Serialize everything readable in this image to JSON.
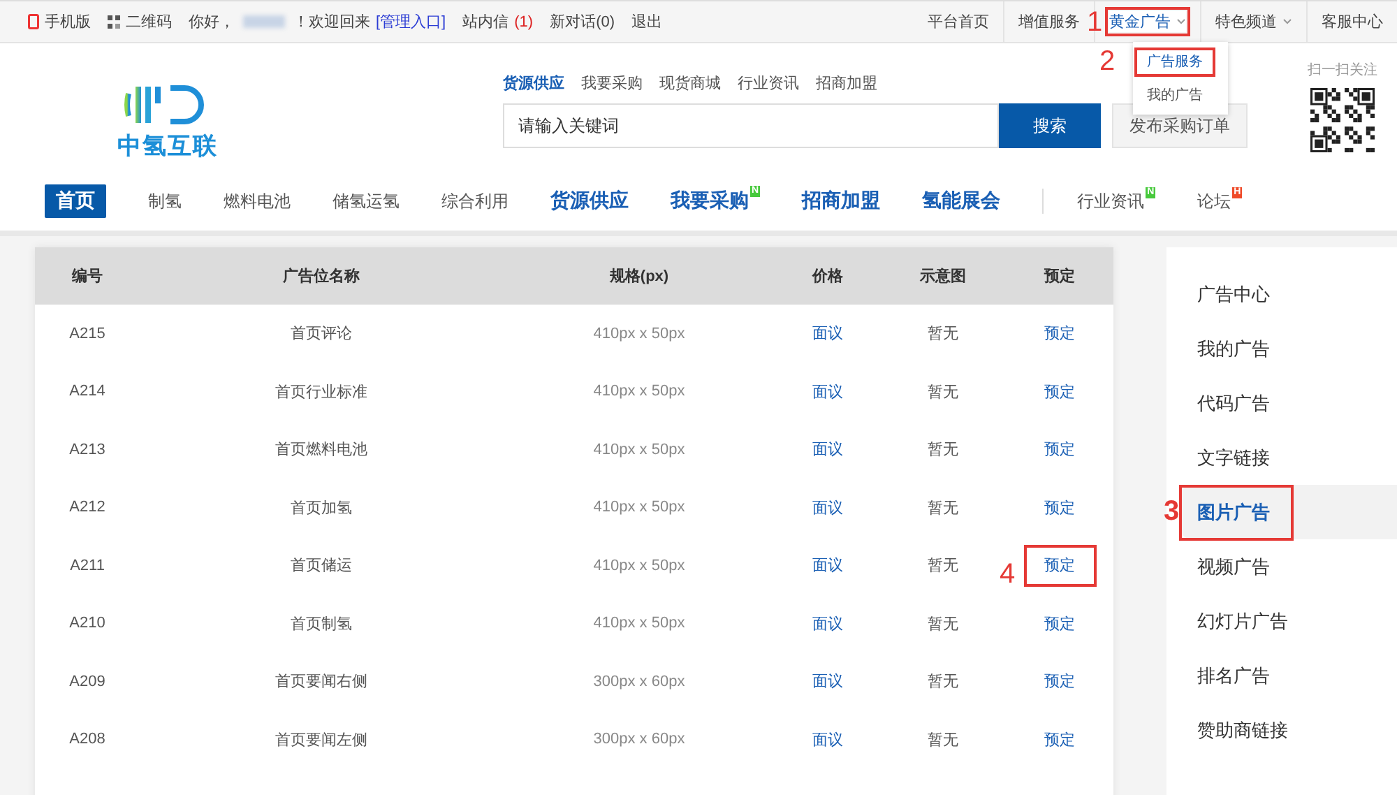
{
  "top_bar": {
    "left": [
      {
        "kind": "mobile",
        "label": "手机版"
      },
      {
        "kind": "qr",
        "label": "二维码"
      }
    ],
    "greeting_before": "你好，",
    "greeting_after": "！欢迎回来",
    "admin_link": "[管理入口]",
    "messages": "站内信",
    "messages_count": "(1)",
    "chats": "新对话(0)",
    "logout": "退出",
    "right": [
      {
        "label": "平台首页",
        "dropdown": false,
        "open": false
      },
      {
        "label": "增值服务",
        "dropdown": false,
        "open": false
      },
      {
        "label": "黄金广告",
        "dropdown": true,
        "annotation": "1",
        "open": true
      },
      {
        "label": "特色频道",
        "dropdown": true,
        "open": false
      },
      {
        "label": "客服中心",
        "dropdown": false,
        "open": false
      }
    ],
    "dropdown_menu": [
      {
        "label": "广告服务",
        "selected": true,
        "annotation": "2"
      },
      {
        "label": "我的广告",
        "selected": false
      }
    ]
  },
  "logo": {
    "text": "中氢互联"
  },
  "search": {
    "links": [
      {
        "label": "货源供应",
        "selected": true
      },
      {
        "label": "我要采购",
        "selected": false
      },
      {
        "label": "现货商城",
        "selected": false
      },
      {
        "label": "行业资讯",
        "selected": false
      },
      {
        "label": "招商加盟",
        "selected": false
      }
    ],
    "placeholder": "请输入关键词",
    "button": "搜索",
    "publish_button": "发布采购订单"
  },
  "qr": {
    "caption": "扫一扫关注"
  },
  "main_nav": [
    {
      "label": "首页",
      "kind": "active"
    },
    {
      "label": "制氢",
      "kind": "plain"
    },
    {
      "label": "燃料电池",
      "kind": "plain"
    },
    {
      "label": "储氢运氢",
      "kind": "plain"
    },
    {
      "label": "综合利用",
      "kind": "plain"
    },
    {
      "label": "货源供应",
      "kind": "featured"
    },
    {
      "label": "我要采购",
      "kind": "featured",
      "badge": "N"
    },
    {
      "label": "招商加盟",
      "kind": "featured"
    },
    {
      "label": "氢能展会",
      "kind": "featured"
    },
    {
      "label": "行业资讯",
      "kind": "plain",
      "badge": "N",
      "divider_before": true
    },
    {
      "label": "论坛",
      "kind": "plain",
      "badge": "H"
    }
  ],
  "table": {
    "columns": [
      "编号",
      "广告位名称",
      "规格(px)",
      "价格",
      "示意图",
      "预定"
    ],
    "rows": [
      {
        "id": "A215",
        "name": "首页评论",
        "size": "410px x 50px",
        "price": "面议",
        "preview": "暂无",
        "book": "预定"
      },
      {
        "id": "A214",
        "name": "首页行业标准",
        "size": "410px x 50px",
        "price": "面议",
        "preview": "暂无",
        "book": "预定"
      },
      {
        "id": "A213",
        "name": "首页燃料电池",
        "size": "410px x 50px",
        "price": "面议",
        "preview": "暂无",
        "book": "预定"
      },
      {
        "id": "A212",
        "name": "首页加氢",
        "size": "410px x 50px",
        "price": "面议",
        "preview": "暂无",
        "book": "预定"
      },
      {
        "id": "A211",
        "name": "首页储运",
        "size": "410px x 50px",
        "price": "面议",
        "preview": "暂无",
        "book": "预定",
        "annotation": "4"
      },
      {
        "id": "A210",
        "name": "首页制氢",
        "size": "410px x 50px",
        "price": "面议",
        "preview": "暂无",
        "book": "预定"
      },
      {
        "id": "A209",
        "name": "首页要闻右侧",
        "size": "300px x 60px",
        "price": "面议",
        "preview": "暂无",
        "book": "预定"
      },
      {
        "id": "A208",
        "name": "首页要闻左侧",
        "size": "300px x 60px",
        "price": "面议",
        "preview": "暂无",
        "book": "预定"
      }
    ]
  },
  "sidebar": {
    "items": [
      {
        "label": "广告中心",
        "selected": false
      },
      {
        "label": "我的广告",
        "selected": false
      },
      {
        "label": "代码广告",
        "selected": false
      },
      {
        "label": "文字链接",
        "selected": false
      },
      {
        "label": "图片广告",
        "selected": true,
        "annotation": "3"
      },
      {
        "label": "视频广告",
        "selected": false
      },
      {
        "label": "幻灯片广告",
        "selected": false
      },
      {
        "label": "排名广告",
        "selected": false
      },
      {
        "label": "赞助商链接",
        "selected": false
      }
    ]
  }
}
